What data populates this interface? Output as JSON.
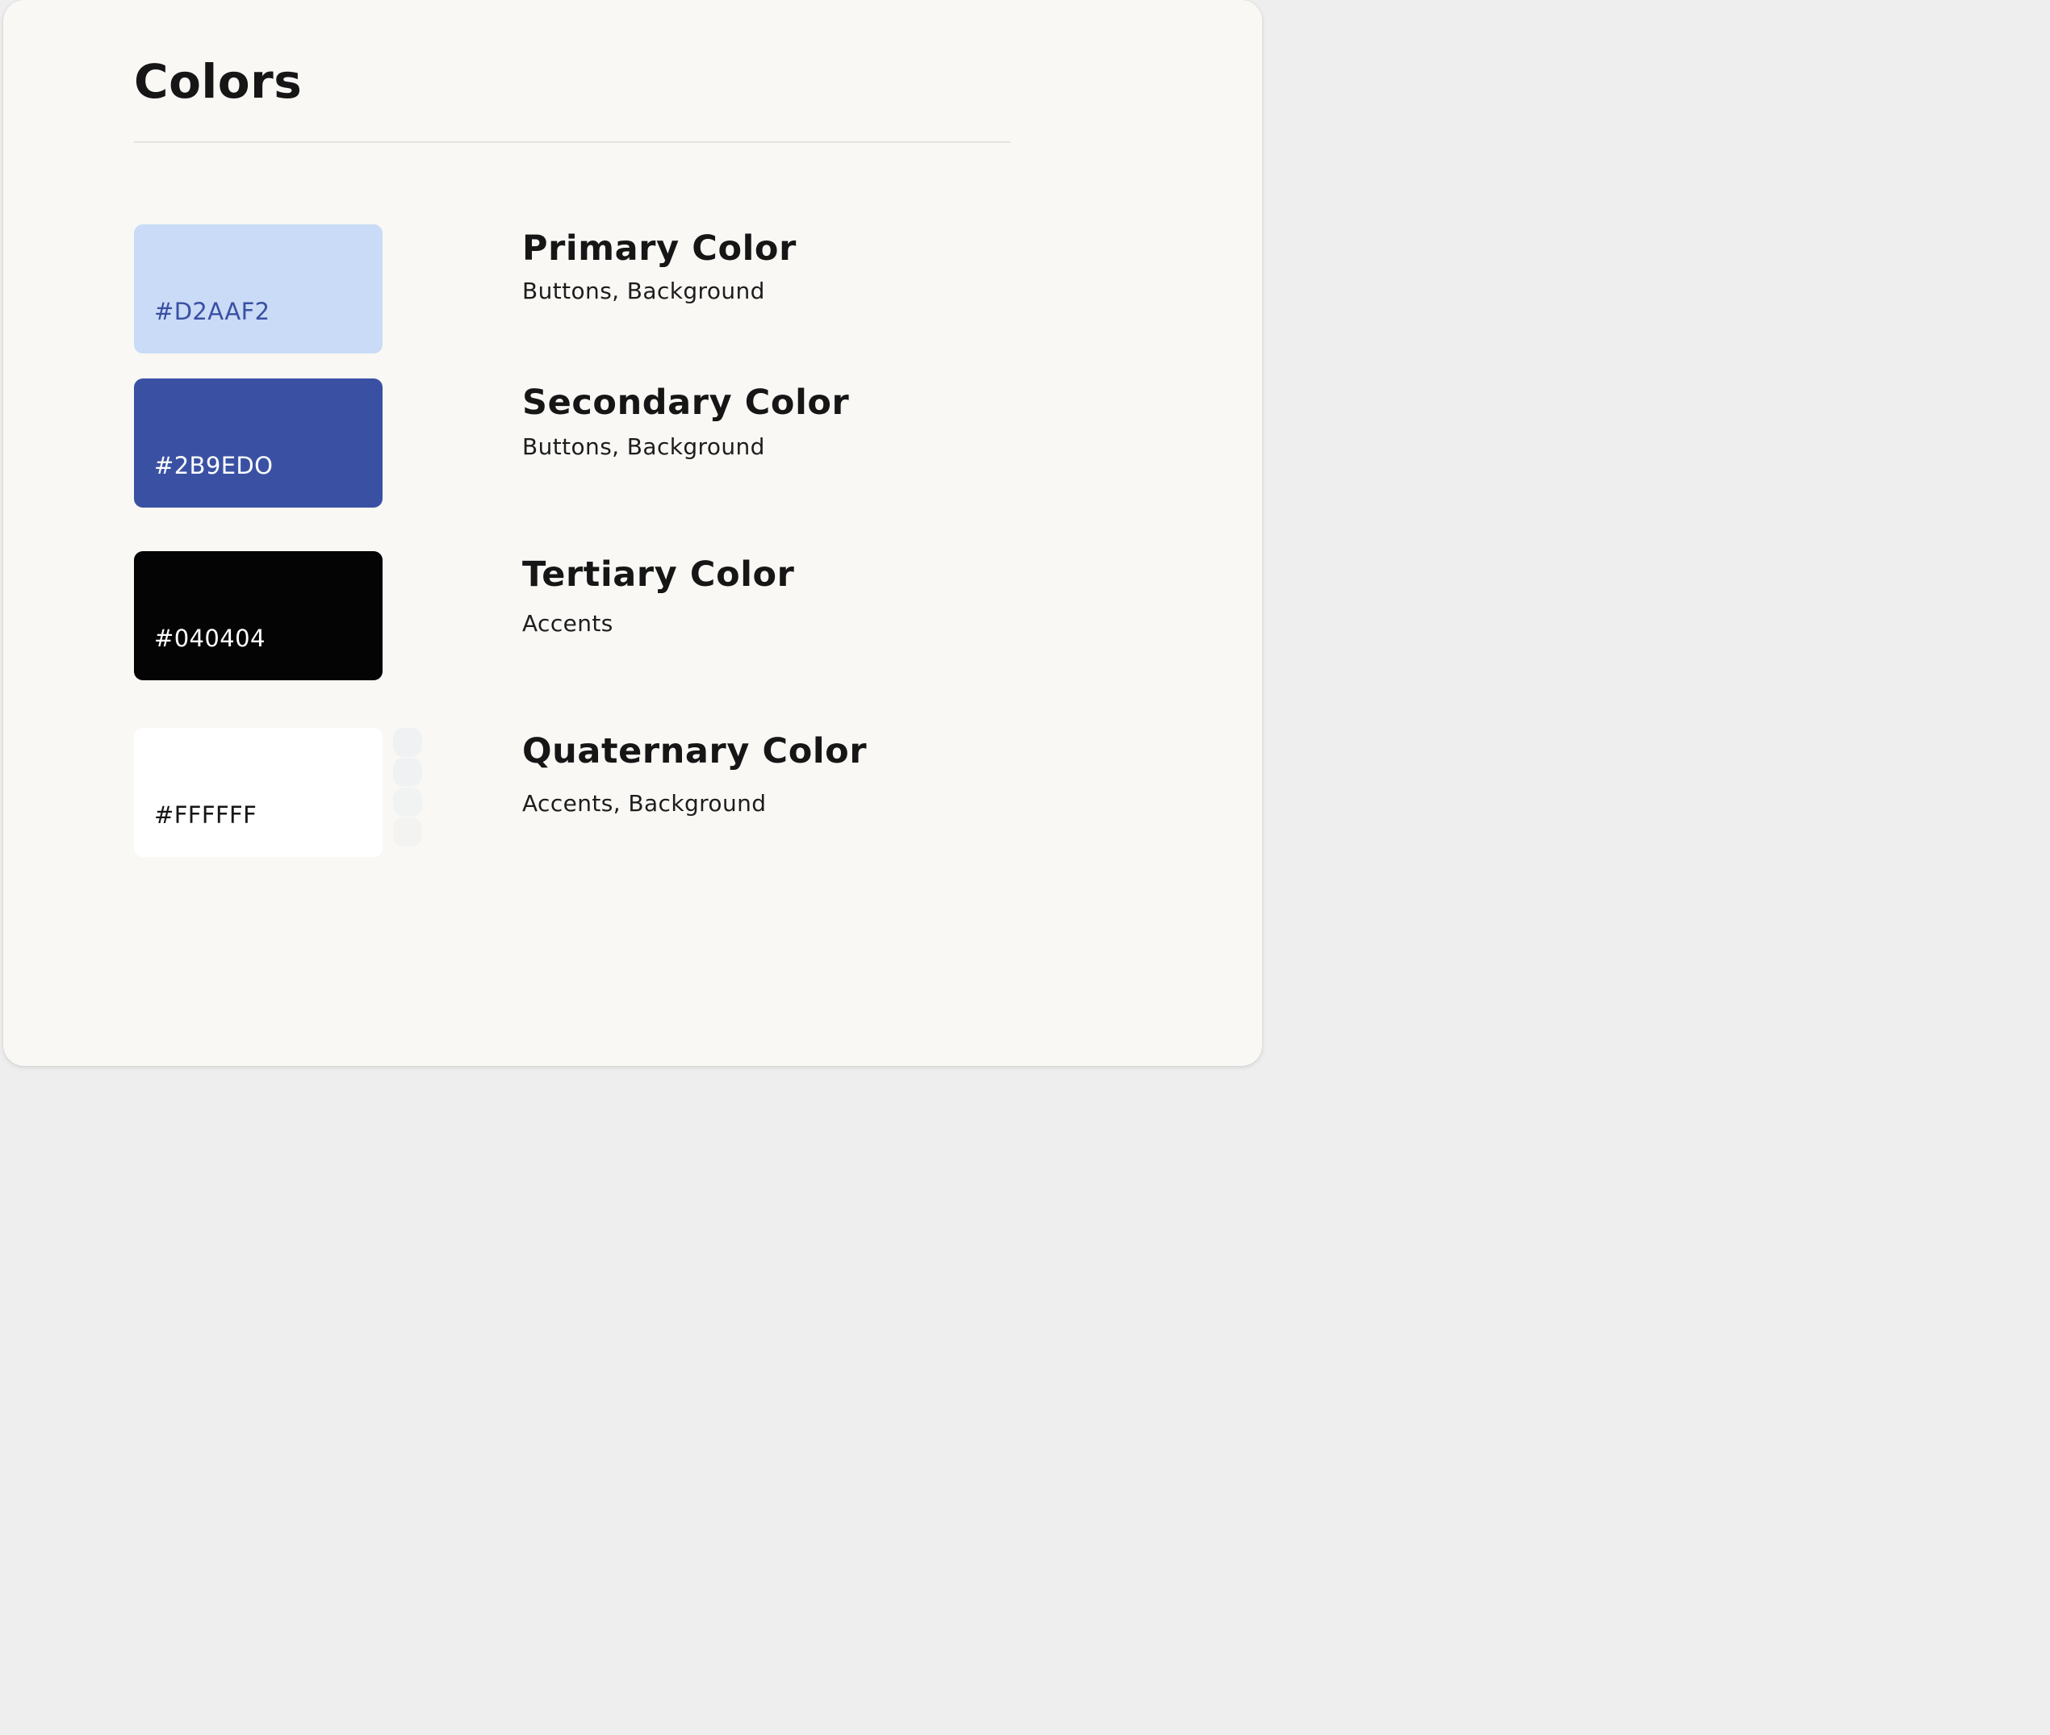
{
  "page": {
    "title": "Colors"
  },
  "colors": [
    {
      "name": "Primary Color",
      "usage": "Buttons, Background",
      "hex_label": "#D2AAF2",
      "fill": "#c9dbf6",
      "text_color": "#3a4fa3"
    },
    {
      "name": "Secondary Color",
      "usage": "Buttons, Background",
      "hex_label": "#2B9EDO",
      "fill": "#3a51a3",
      "text_color": "#ffffff"
    },
    {
      "name": "Tertiary Color",
      "usage": "Accents",
      "hex_label": "#040404",
      "fill": "#040404",
      "text_color": "#ffffff"
    },
    {
      "name": "Quaternary Color",
      "usage": "Accents, Background",
      "hex_label": "#FFFFFF",
      "fill": "#ffffff",
      "text_color": "#161616"
    }
  ],
  "quaternary_tints": [
    "#eff1f2",
    "#f0f1f2",
    "#f1f2f2",
    "#f3f3f2"
  ]
}
